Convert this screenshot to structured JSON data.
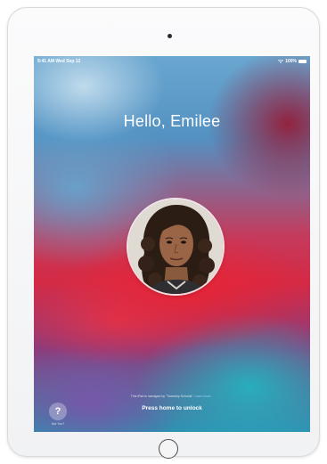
{
  "status_bar": {
    "time_date": "9:41 AM  Wed Sep 12",
    "battery_percent": "100%",
    "battery_level": 1.0,
    "wifi_icon": "wifi-icon",
    "battery_icon": "battery-icon"
  },
  "lock_screen": {
    "greeting": "Hello, Emilee",
    "managed_notice": "This iPad is managed by \"Township Schools\".",
    "learn_more": "Learn more...",
    "unlock_hint": "Press home to unlock",
    "help_glyph": "?",
    "help_label": "Not You?"
  },
  "colors": {
    "wallpaper_red": "#d42a45",
    "wallpaper_blue": "#5391c2",
    "wallpaper_teal": "#24b2c0",
    "link_color": "#9bd2ff"
  }
}
